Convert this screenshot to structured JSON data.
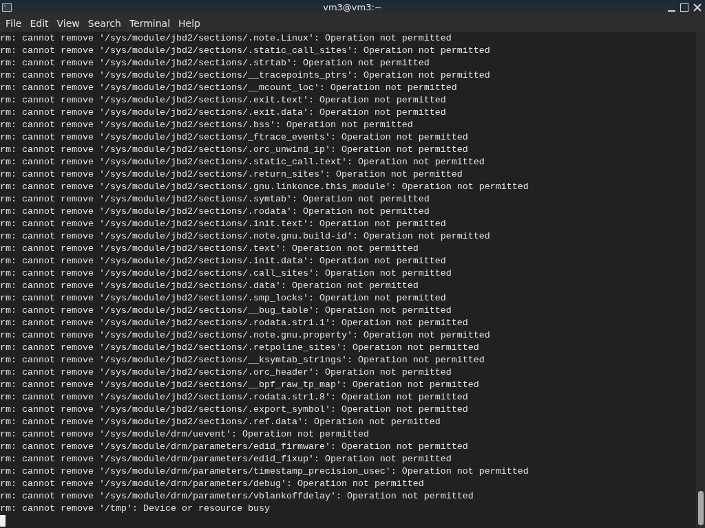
{
  "window": {
    "title": "vm3@vm3:~"
  },
  "menu": [
    "File",
    "Edit",
    "View",
    "Search",
    "Terminal",
    "Help"
  ],
  "terminal": {
    "lines": [
      "rm: cannot remove '/sys/module/jbd2/sections/.note.Linux': Operation not permitted",
      "rm: cannot remove '/sys/module/jbd2/sections/.static_call_sites': Operation not permitted",
      "rm: cannot remove '/sys/module/jbd2/sections/.strtab': Operation not permitted",
      "rm: cannot remove '/sys/module/jbd2/sections/__tracepoints_ptrs': Operation not permitted",
      "rm: cannot remove '/sys/module/jbd2/sections/__mcount_loc': Operation not permitted",
      "rm: cannot remove '/sys/module/jbd2/sections/.exit.text': Operation not permitted",
      "rm: cannot remove '/sys/module/jbd2/sections/.exit.data': Operation not permitted",
      "rm: cannot remove '/sys/module/jbd2/sections/.bss': Operation not permitted",
      "rm: cannot remove '/sys/module/jbd2/sections/_ftrace_events': Operation not permitted",
      "rm: cannot remove '/sys/module/jbd2/sections/.orc_unwind_ip': Operation not permitted",
      "rm: cannot remove '/sys/module/jbd2/sections/.static_call.text': Operation not permitted",
      "rm: cannot remove '/sys/module/jbd2/sections/.return_sites': Operation not permitted",
      "rm: cannot remove '/sys/module/jbd2/sections/.gnu.linkonce.this_module': Operation not permitted",
      "rm: cannot remove '/sys/module/jbd2/sections/.symtab': Operation not permitted",
      "rm: cannot remove '/sys/module/jbd2/sections/.rodata': Operation not permitted",
      "rm: cannot remove '/sys/module/jbd2/sections/.init.text': Operation not permitted",
      "rm: cannot remove '/sys/module/jbd2/sections/.note.gnu.build-id': Operation not permitted",
      "rm: cannot remove '/sys/module/jbd2/sections/.text': Operation not permitted",
      "rm: cannot remove '/sys/module/jbd2/sections/.init.data': Operation not permitted",
      "rm: cannot remove '/sys/module/jbd2/sections/.call_sites': Operation not permitted",
      "rm: cannot remove '/sys/module/jbd2/sections/.data': Operation not permitted",
      "rm: cannot remove '/sys/module/jbd2/sections/.smp_locks': Operation not permitted",
      "rm: cannot remove '/sys/module/jbd2/sections/__bug_table': Operation not permitted",
      "rm: cannot remove '/sys/module/jbd2/sections/.rodata.str1.1': Operation not permitted",
      "rm: cannot remove '/sys/module/jbd2/sections/.note.gnu.property': Operation not permitted",
      "rm: cannot remove '/sys/module/jbd2/sections/.retpoline_sites': Operation not permitted",
      "rm: cannot remove '/sys/module/jbd2/sections/__ksymtab_strings': Operation not permitted",
      "rm: cannot remove '/sys/module/jbd2/sections/.orc_header': Operation not permitted",
      "rm: cannot remove '/sys/module/jbd2/sections/__bpf_raw_tp_map': Operation not permitted",
      "rm: cannot remove '/sys/module/jbd2/sections/.rodata.str1.8': Operation not permitted",
      "rm: cannot remove '/sys/module/jbd2/sections/.export_symbol': Operation not permitted",
      "rm: cannot remove '/sys/module/jbd2/sections/.ref.data': Operation not permitted",
      "rm: cannot remove '/sys/module/drm/uevent': Operation not permitted",
      "rm: cannot remove '/sys/module/drm/parameters/edid_firmware': Operation not permitted",
      "rm: cannot remove '/sys/module/drm/parameters/edid_fixup': Operation not permitted",
      "rm: cannot remove '/sys/module/drm/parameters/timestamp_precision_usec': Operation not permitted",
      "rm: cannot remove '/sys/module/drm/parameters/debug': Operation not permitted",
      "rm: cannot remove '/sys/module/drm/parameters/vblankoffdelay': Operation not permitted",
      "rm: cannot remove '/tmp': Device or resource busy"
    ]
  }
}
